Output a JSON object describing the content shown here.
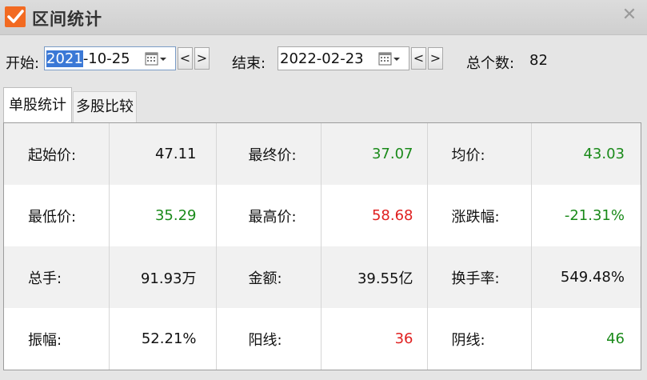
{
  "window": {
    "title": "区间统计"
  },
  "toolbar": {
    "start_label": "开始:",
    "start_date_selected": "2021",
    "start_date_rest": "-10-25",
    "end_label": "结束:",
    "end_date": "2022-02-23",
    "prev_label": "<",
    "next_label": ">",
    "count_label": "总个数:",
    "count_value": "82"
  },
  "tabs": [
    {
      "label": "单股统计",
      "active": true
    },
    {
      "label": "多股比较",
      "active": false
    }
  ],
  "colors": {
    "up": "#e02020",
    "down": "#1a8a1a",
    "neutral": "#111111",
    "accent": "#f26a21"
  },
  "stats": [
    [
      {
        "label": "起始价:",
        "value": "47.11",
        "tone": "neutral"
      },
      {
        "label": "最终价:",
        "value": "37.07",
        "tone": "down"
      },
      {
        "label": "均价:",
        "value": "43.03",
        "tone": "down"
      }
    ],
    [
      {
        "label": "最低价:",
        "value": "35.29",
        "tone": "down"
      },
      {
        "label": "最高价:",
        "value": "58.68",
        "tone": "up"
      },
      {
        "label": "涨跌幅:",
        "value": "-21.31%",
        "tone": "down"
      }
    ],
    [
      {
        "label": "总手:",
        "value": "91.93万",
        "tone": "neutral"
      },
      {
        "label": "金额:",
        "value": "39.55亿",
        "tone": "neutral"
      },
      {
        "label": "换手率:",
        "value": "549.48%",
        "tone": "neutral"
      }
    ],
    [
      {
        "label": "振幅:",
        "value": "52.21%",
        "tone": "neutral"
      },
      {
        "label": "阳线:",
        "value": "36",
        "tone": "up"
      },
      {
        "label": "阴线:",
        "value": "46",
        "tone": "down"
      }
    ]
  ]
}
